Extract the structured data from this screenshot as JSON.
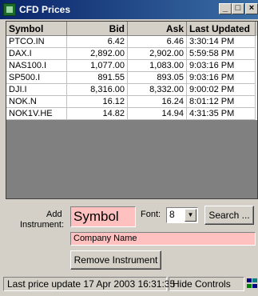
{
  "window": {
    "title": "CFD Prices"
  },
  "titlebar": {
    "minimize": "_",
    "maximize": "□",
    "close": "×"
  },
  "grid": {
    "headers": [
      "Symbol",
      "Bid",
      "Ask",
      "Last Updated"
    ],
    "rows": [
      {
        "symbol": "PTCO.IN",
        "bid": "6.42",
        "ask": "6.46",
        "updated": "3:30:14 PM"
      },
      {
        "symbol": "DAX.I",
        "bid": "2,892.00",
        "ask": "2,902.00",
        "updated": "5:59:58 PM"
      },
      {
        "symbol": "NAS100.I",
        "bid": "1,077.00",
        "ask": "1,083.00",
        "updated": "9:03:16 PM"
      },
      {
        "symbol": "SP500.I",
        "bid": "891.55",
        "ask": "893.05",
        "updated": "9:03:16 PM"
      },
      {
        "symbol": "DJI.I",
        "bid": "8,316.00",
        "ask": "8,332.00",
        "updated": "9:00:02 PM"
      },
      {
        "symbol": "NOK.N",
        "bid": "16.12",
        "ask": "16.24",
        "updated": "8:01:12 PM"
      },
      {
        "symbol": "NOK1V.HE",
        "bid": "14.82",
        "ask": "14.94",
        "updated": "4:31:35 PM"
      }
    ]
  },
  "panel": {
    "add_label_1": "Add",
    "add_label_2": "Instrument:",
    "symbol_placeholder": "Symbol",
    "font_label": "Font:",
    "font_value": "8",
    "search_label": "Search ...",
    "company_placeholder": "Company Name",
    "remove_label": "Remove Instrument"
  },
  "statusbar": {
    "last_update": "Last price update 17 Apr 2003 16:31:35",
    "hide_controls": "Hide Controls"
  },
  "colors": {
    "title_start": "#0a246a",
    "title_end": "#3a6ea5",
    "input_bg": "#ffc0c0",
    "grid_bg": "#808080"
  },
  "icons": {
    "app": "app-icon",
    "resize": "resize-grip-icon"
  }
}
